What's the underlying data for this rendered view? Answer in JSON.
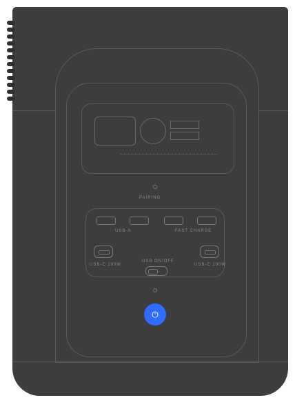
{
  "device": {
    "pairing_label": "PAIRING",
    "usb_a_label": "USB-A",
    "fast_charge_label": "FAST CHARGE",
    "usb_c_left_label": "USB-C 100W",
    "usb_c_right_label": "USB-C 100W",
    "usb_switch_label": "USB ON/OFF",
    "power_symbol": "⏻",
    "accent_color": "#2e6dff"
  }
}
